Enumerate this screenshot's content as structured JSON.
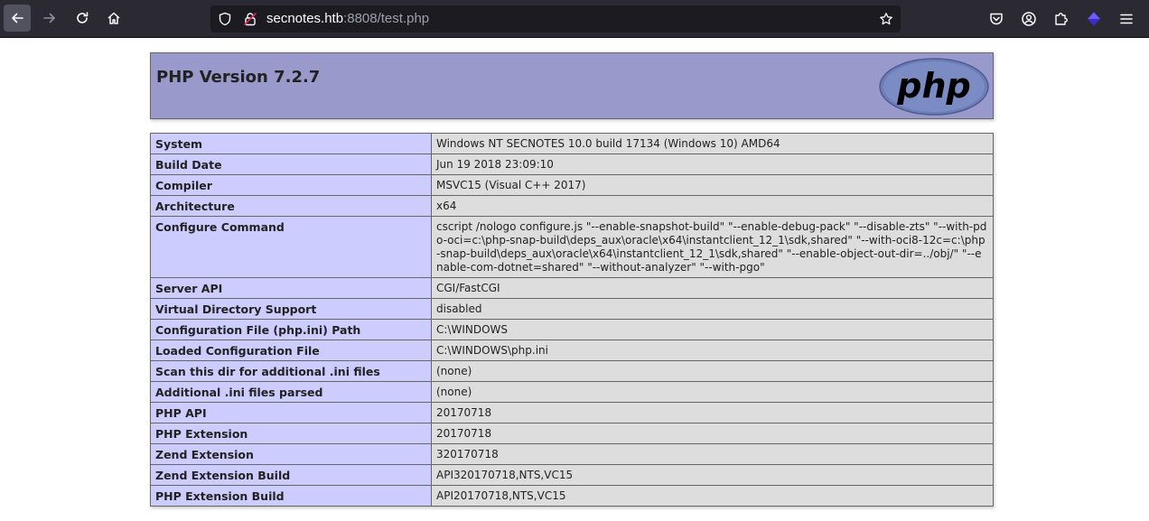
{
  "browser": {
    "url_host": "secnotes.htb",
    "url_rest": ":8808/test.php",
    "colors": {
      "toolbar": "#2b2a33",
      "urlbar": "#1c1b22"
    }
  },
  "phpinfo": {
    "title": "PHP Version 7.2.7",
    "logo_text": "php",
    "colors": {
      "header": "#9999cc",
      "key_cell": "#ccccff",
      "value_cell": "#dddddd"
    },
    "rows": [
      {
        "key": "System",
        "value": "Windows NT SECNOTES 10.0 build 17134 (Windows 10) AMD64"
      },
      {
        "key": "Build Date",
        "value": "Jun 19 2018 23:09:10"
      },
      {
        "key": "Compiler",
        "value": "MSVC15 (Visual C++ 2017)"
      },
      {
        "key": "Architecture",
        "value": "x64"
      },
      {
        "key": "Configure Command",
        "value": "cscript /nologo configure.js \"--enable-snapshot-build\" \"--enable-debug-pack\" \"--disable-zts\" \"--with-pdo-oci=c:\\php-snap-build\\deps_aux\\oracle\\x64\\instantclient_12_1\\sdk,shared\" \"--with-oci8-12c=c:\\php-snap-build\\deps_aux\\oracle\\x64\\instantclient_12_1\\sdk,shared\" \"--enable-object-out-dir=../obj/\" \"--enable-com-dotnet=shared\" \"--without-analyzer\" \"--with-pgo\""
      },
      {
        "key": "Server API",
        "value": "CGI/FastCGI"
      },
      {
        "key": "Virtual Directory Support",
        "value": "disabled"
      },
      {
        "key": "Configuration File (php.ini) Path",
        "value": "C:\\WINDOWS"
      },
      {
        "key": "Loaded Configuration File",
        "value": "C:\\WINDOWS\\php.ini"
      },
      {
        "key": "Scan this dir for additional .ini files",
        "value": "(none)"
      },
      {
        "key": "Additional .ini files parsed",
        "value": "(none)"
      },
      {
        "key": "PHP API",
        "value": "20170718"
      },
      {
        "key": "PHP Extension",
        "value": "20170718"
      },
      {
        "key": "Zend Extension",
        "value": "320170718"
      },
      {
        "key": "Zend Extension Build",
        "value": "API320170718,NTS,VC15"
      },
      {
        "key": "PHP Extension Build",
        "value": "API20170718,NTS,VC15"
      }
    ]
  },
  "icons": {
    "back": "arrow-left-icon",
    "forward": "arrow-right-icon",
    "reload": "reload-icon",
    "home": "home-icon",
    "tracking": "shield-icon",
    "insecure": "lock-warning-icon",
    "bookmark": "star-icon",
    "pocket": "pocket-icon",
    "account": "account-icon",
    "extensions": "puzzle-icon",
    "addon": "cube-icon",
    "menu": "hamburger-menu-icon"
  }
}
